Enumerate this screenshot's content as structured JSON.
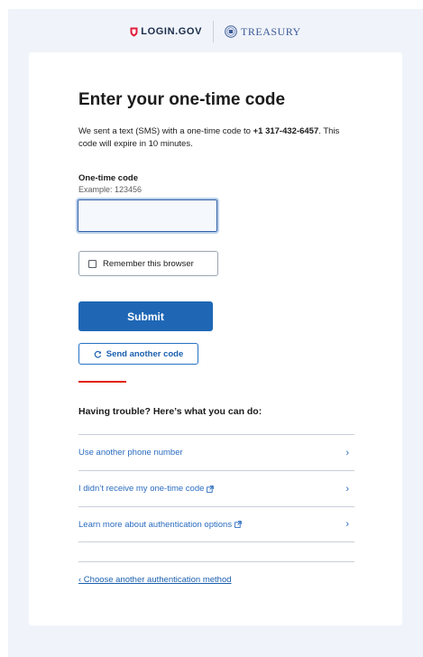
{
  "header": {
    "login_logo_text": "LOGIN.GOV",
    "partner_name": "TREASURY",
    "shield_icon": "shield-icon",
    "seal_icon": "treasury-seal-icon",
    "brand_red": "#e21c3d",
    "brand_navy": "#1a2b4a"
  },
  "page": {
    "title": "Enter your one-time code",
    "lede_prefix": "We sent a text (SMS) with a one-time code to ",
    "phone_number": "+1 317-432-6457",
    "lede_suffix": ". This code will expire in 10 minutes."
  },
  "form": {
    "code_label": "One-time code",
    "code_hint": "Example: 123456",
    "code_value": "",
    "remember_label": "Remember this browser",
    "remember_checked": false,
    "submit_label": "Submit",
    "resend_label": "Send another code",
    "primary_color": "#1f67b5"
  },
  "trouble": {
    "heading": "Having trouble? Here’s what you can do:",
    "items": [
      {
        "label": "Use another phone number",
        "external": false
      },
      {
        "label": "I didn’t receive my one-time code",
        "external": true
      },
      {
        "label": "Learn more about authentication options",
        "external": true
      }
    ],
    "accent_color": "#e52207"
  },
  "footer": {
    "choose_another_label": "‹ Choose another authentication method"
  }
}
